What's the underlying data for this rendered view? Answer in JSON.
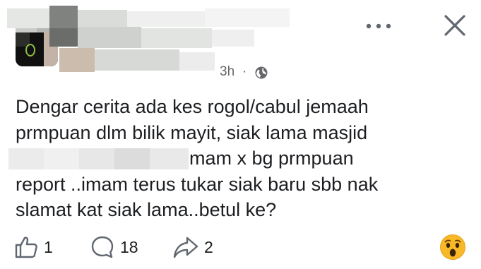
{
  "post": {
    "timestamp": "3h",
    "separator": "·",
    "audience_icon": "globe-icon",
    "text_lines": [
      "Dengar cerita ada kes rogol/cabul jemaah",
      "prmpuan dlm bilik mayit, siak lama masjid",
      "imam x bg prmpuan",
      "report ..imam terus tukar siak baru sbb nak",
      "slamat kat siak lama..betul ke?"
    ]
  },
  "header": {
    "more_icon": "more-horizontal-icon",
    "close_icon": "close-icon"
  },
  "actions": {
    "likes": "1",
    "comments": "18",
    "shares": "2",
    "reaction_icon": "wow-emoji-icon"
  },
  "colors": {
    "text": "#1c1e21",
    "secondary": "#65676b",
    "icon": "#606770",
    "wow_emoji": "#f7b928"
  }
}
